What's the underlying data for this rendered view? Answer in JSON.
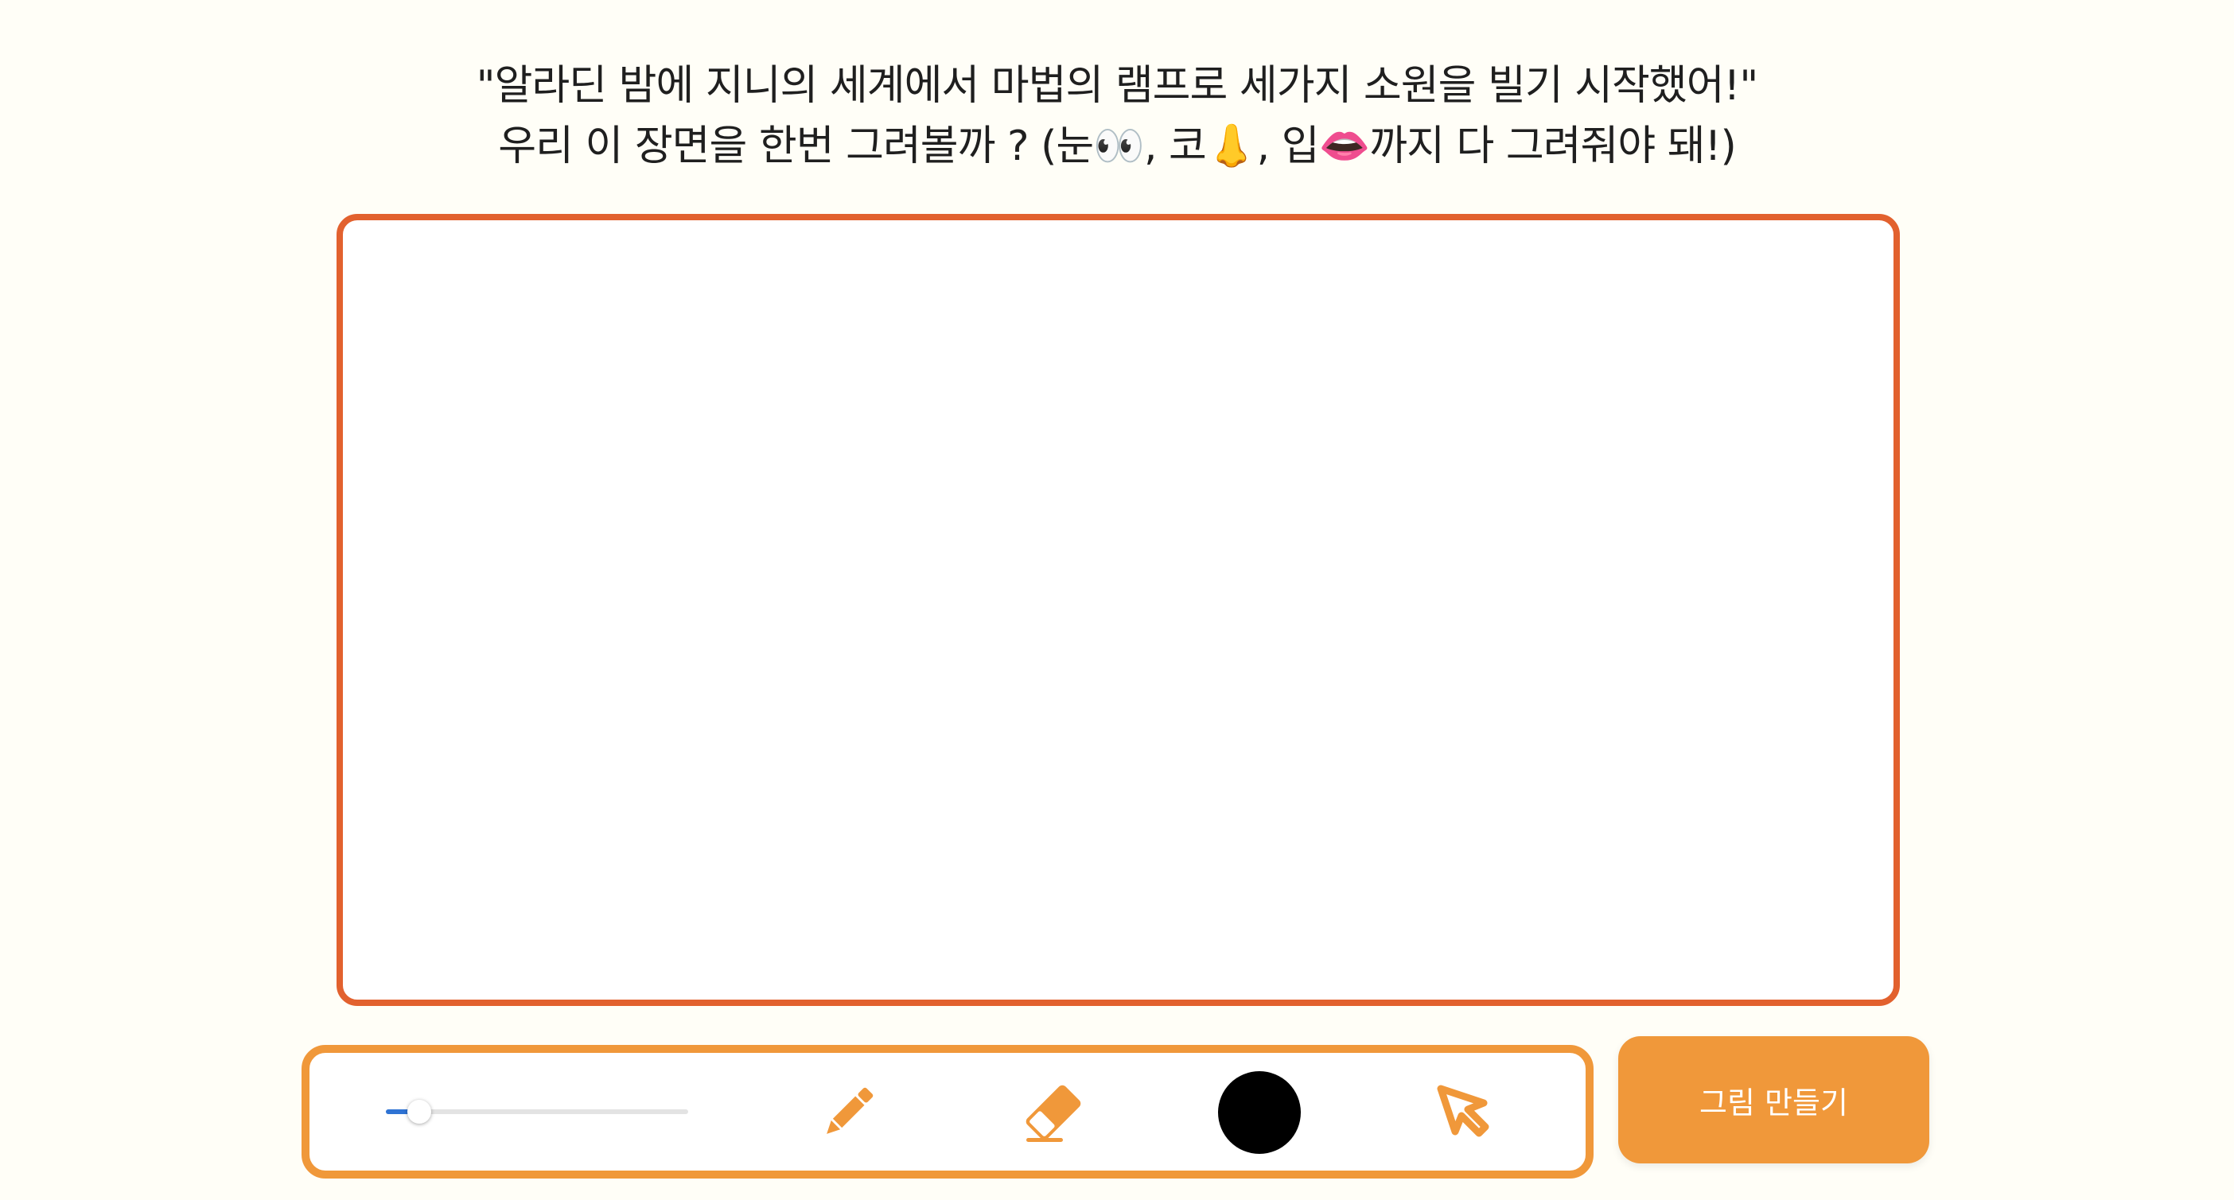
{
  "prompt": {
    "line1": "\"알라딘 밤에 지니의 세계에서 마법의 램프로 세가지 소원을 빌기 시작했어!\"",
    "line2": "우리 이 장면을 한번 그려볼까 ? (눈👀, 코👃, 입👄까지 다 그려줘야 돼!)"
  },
  "canvas": {
    "border_color": "#E2612E",
    "background": "#FFFFFF"
  },
  "toolbar": {
    "border_color": "#F0983A",
    "brush_size": {
      "min": 0,
      "max": 100,
      "value": 11
    },
    "tools": {
      "pencil_icon": "pencil-icon",
      "eraser_icon": "eraser-icon",
      "cursor_icon": "cursor-icon"
    },
    "current_color": "#000000",
    "icon_color": "#F0983A",
    "slider_color": "#2F73D4"
  },
  "actions": {
    "make_picture_label": "그림 만들기",
    "button_color": "#F0983A"
  }
}
